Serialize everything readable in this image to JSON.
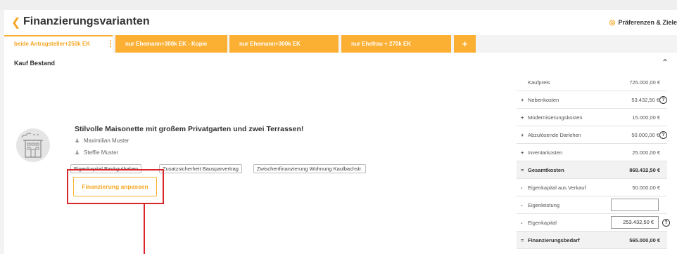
{
  "header": {
    "back_icon": "chevron-left-icon",
    "title": "Finanzierungsvarianten",
    "preferences_label": "Präferenzen & Ziele",
    "preferences_icon": "target-icon"
  },
  "tabs": [
    {
      "label": "beide Antragsteller+250k EK",
      "active": true
    },
    {
      "label": "nur Ehemann+300k EK - Kopie",
      "active": false
    },
    {
      "label": "nur Ehemann+300k EK",
      "active": false
    },
    {
      "label": "nur Ehefrau + 270k EK",
      "active": false
    }
  ],
  "tab_more_label": "⋮",
  "tab_add_label": "+",
  "section": {
    "title": "Kauf Bestand",
    "collapse_icon": "chevron-up-icon"
  },
  "listing": {
    "title": "Stilvolle Maisonette mit großem Privatgarten und zwei Terrassen!",
    "persons": [
      "Maximilian Muster",
      "Steffie Muster"
    ],
    "tags": [
      "Eigenkapital Bankguthaben",
      "Zusatzsicherheit Bausparvertrag",
      "Zwischenfinanzierung Wohnung Kaulbachstr."
    ],
    "adjust_button": "Finanzierung anpassen"
  },
  "colors": {
    "accent": "#fbb034",
    "accent_text": "#f5a623",
    "highlight": "#d9262b"
  },
  "summary": [
    {
      "sign": "",
      "label": "Kaufpreis",
      "value": "725.000,00 €",
      "bold": false
    },
    {
      "sign": "+",
      "label": "Nebenkosten",
      "value": "53.432,50 €",
      "bold": false,
      "help": "?"
    },
    {
      "sign": "+",
      "label": "Modernisierungskosten",
      "value": "15.000,00 €",
      "bold": false
    },
    {
      "sign": "+",
      "label": "Abzulösende Darlehen",
      "value": "50.000,00 €",
      "bold": false,
      "help": "?"
    },
    {
      "sign": "+",
      "label": "Inventarkosten",
      "value": "25.000,00 €",
      "bold": false
    },
    {
      "sign": "=",
      "label": "Gesamtkosten",
      "value": "868.432,50 €",
      "bold": true
    },
    {
      "sign": "-",
      "label": "Eigenkapital aus Verkauf",
      "value": "50.000,00 €",
      "bold": false
    },
    {
      "sign": "-",
      "label": "Eigenleistung",
      "input": "",
      "bold": false
    },
    {
      "sign": "-",
      "label": "Eigenkapital",
      "input": "253.432,50 €",
      "bold": false,
      "help": "?"
    },
    {
      "sign": "=",
      "label": "Finanzierungsbedarf",
      "value": "565.000,00 €",
      "bold": true
    }
  ]
}
